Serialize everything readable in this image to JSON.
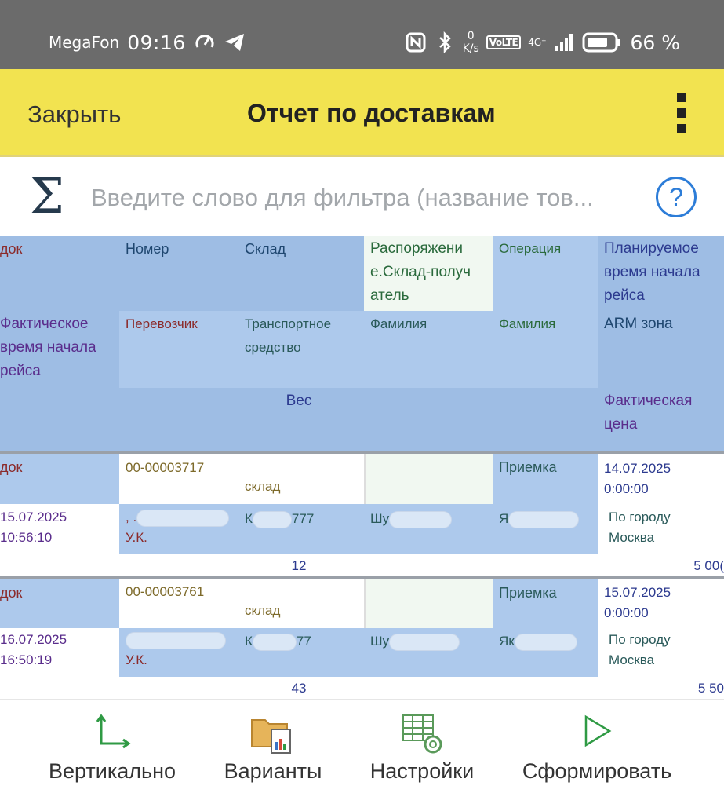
{
  "status_bar": {
    "carrier": "MegaFon",
    "time": "09:16",
    "net_speed_value": "0",
    "net_speed_unit": "K/s",
    "volte": "VoLTE",
    "network": "4G⁺",
    "battery_percent": "66 %"
  },
  "header": {
    "close_label": "Закрыть",
    "title": "Отчет по доставкам"
  },
  "filter": {
    "placeholder": "Введите слово для фильтра (название тов..."
  },
  "report": {
    "headers": {
      "doc": "док",
      "number": "Номер",
      "warehouse": "Склад",
      "order_warehouse": "Распоряжени е.Склад-получ атель",
      "operation": "Операция",
      "planned_start": "Планируемое время начала рейса",
      "actual_start": "Фактическое время начала рейса",
      "carrier": "Перевозчик",
      "vehicle": "Транспортное средство",
      "surname1": "Фамилия",
      "surname2": "Фамилия",
      "arm_zone": "ARM зона",
      "weight": "Вес",
      "actual_price": "Фактическая цена"
    },
    "rows": [
      {
        "doc": "док",
        "number": "00-00003717",
        "warehouse": "склад",
        "operation": "Приемка",
        "planned_start": "14.07.2025 0:00:00",
        "actual_start": "15.07.2025 10:56:10",
        "carrier_prefix": ", .",
        "carrier_suffix": "У.К.",
        "vehicle_prefix": "К",
        "vehicle_suffix": "777",
        "surname1": "Шу",
        "surname2": "Я",
        "arm_zone": "По городу Москва",
        "weight": "12",
        "price": "5 00("
      },
      {
        "doc": "док",
        "number": "00-00003761",
        "warehouse": "склад",
        "operation": "Приемка",
        "planned_start": "15.07.2025 0:00:00",
        "actual_start": "16.07.2025 16:50:19",
        "carrier_prefix": "",
        "carrier_suffix": "У.К.",
        "vehicle_prefix": "К",
        "vehicle_suffix": "77",
        "surname1": "Шу",
        "surname2": "Як",
        "arm_zone": "По городу Москва",
        "weight": "43",
        "price": "5 50"
      }
    ]
  },
  "toolbar": {
    "vertical": "Вертикально",
    "variants": "Варианты",
    "settings": "Настройки",
    "generate": "Сформировать"
  },
  "colors": {
    "header_bg": "#f2e350",
    "grid_blue": "#adc9ec",
    "help_blue": "#2d7dd8",
    "status_bar_bg": "#6b6b6b"
  },
  "icons": [
    "speedometer-icon",
    "telegram-icon",
    "nfc-icon",
    "bluetooth-icon",
    "signal-icon",
    "battery-icon",
    "sigma-icon",
    "help-icon",
    "more-vertical-icon",
    "axes-icon",
    "folder-report-icon",
    "table-settings-icon",
    "play-icon"
  ]
}
